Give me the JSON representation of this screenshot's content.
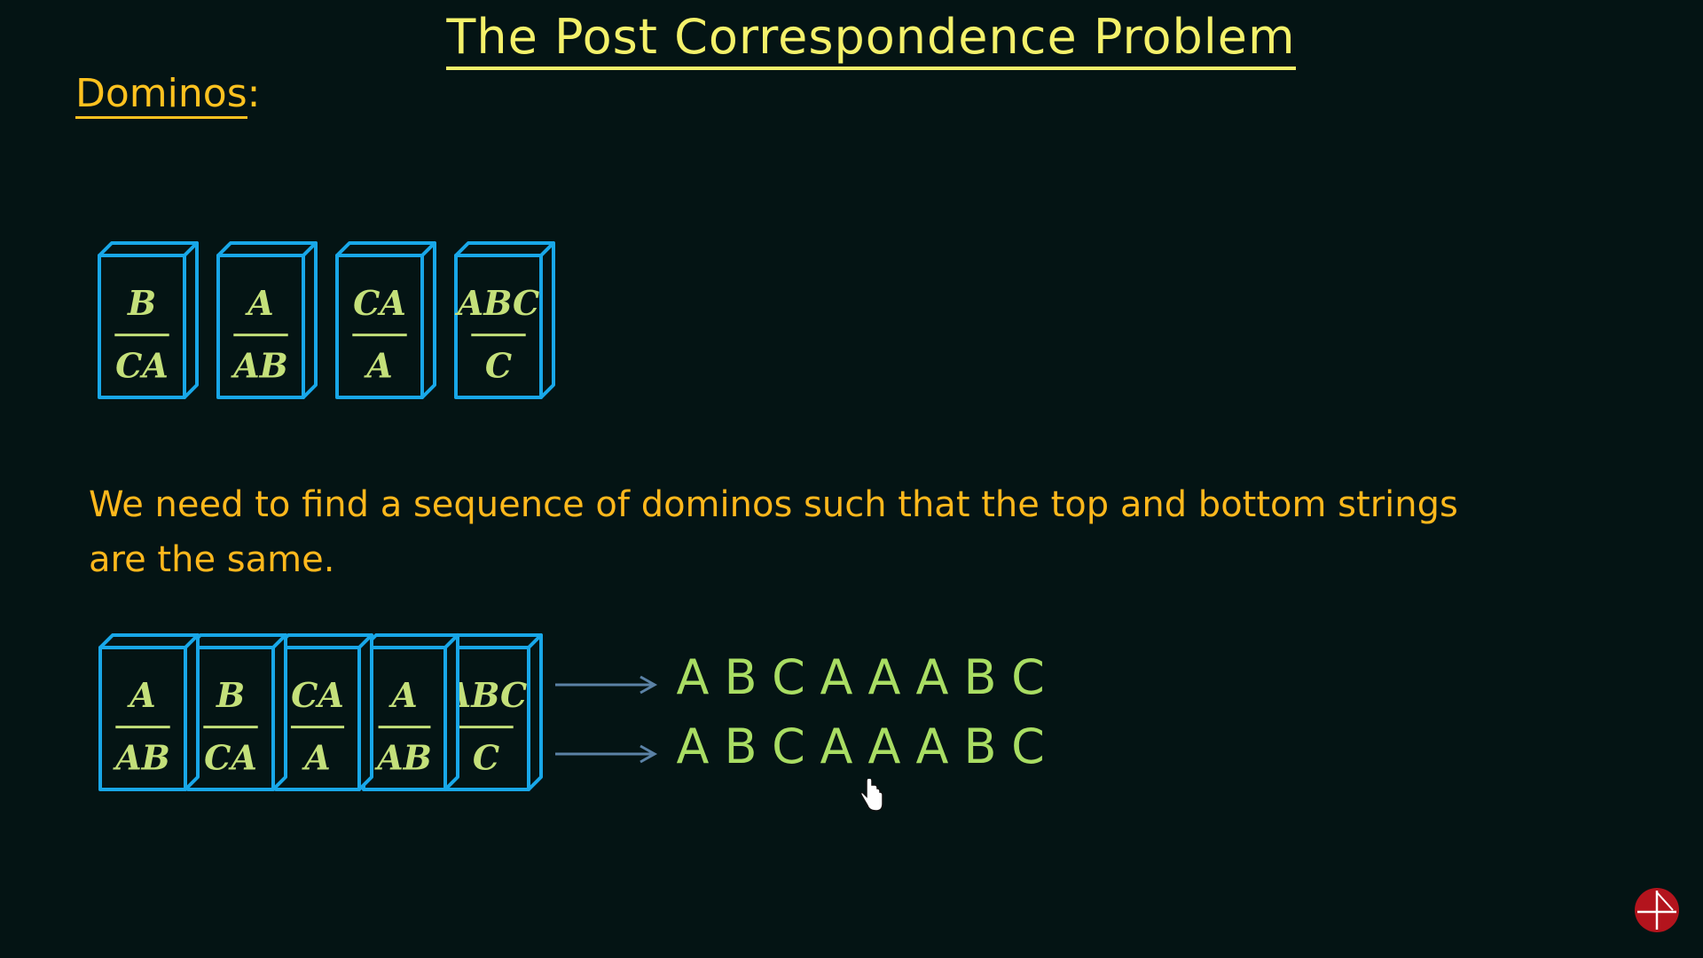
{
  "title": "The Post Correspondence Problem",
  "section": {
    "label": "Dominos",
    "suffix": ":"
  },
  "dominos": [
    {
      "top": "B",
      "bottom": "CA"
    },
    {
      "top": "A",
      "bottom": "AB"
    },
    {
      "top": "CA",
      "bottom": "A"
    },
    {
      "top": "ABC",
      "bottom": "C"
    }
  ],
  "description": "We need to find a sequence of dominos such that the top and bottom strings are the same.",
  "sequence": [
    {
      "top": "A",
      "bottom": "AB"
    },
    {
      "top": "B",
      "bottom": "CA"
    },
    {
      "top": "CA",
      "bottom": "A"
    },
    {
      "top": "A",
      "bottom": "AB"
    },
    {
      "top": "ABC",
      "bottom": "C"
    }
  ],
  "result": {
    "top": [
      "A",
      "B",
      "C",
      "A",
      "A",
      "A",
      "B",
      "C"
    ],
    "bottom": [
      "A",
      "B",
      "C",
      "A",
      "A",
      "A",
      "B",
      "C"
    ]
  },
  "colors": {
    "background": "#041414",
    "title": "#f4f16a",
    "label": "#ffc21f",
    "domino_border": "#18a7e8",
    "domino_text": "#c4e07a",
    "result_text": "#a9dd63"
  },
  "icons": {
    "cursor": "hand-cursor-icon",
    "logo": "channel-logo-icon"
  }
}
